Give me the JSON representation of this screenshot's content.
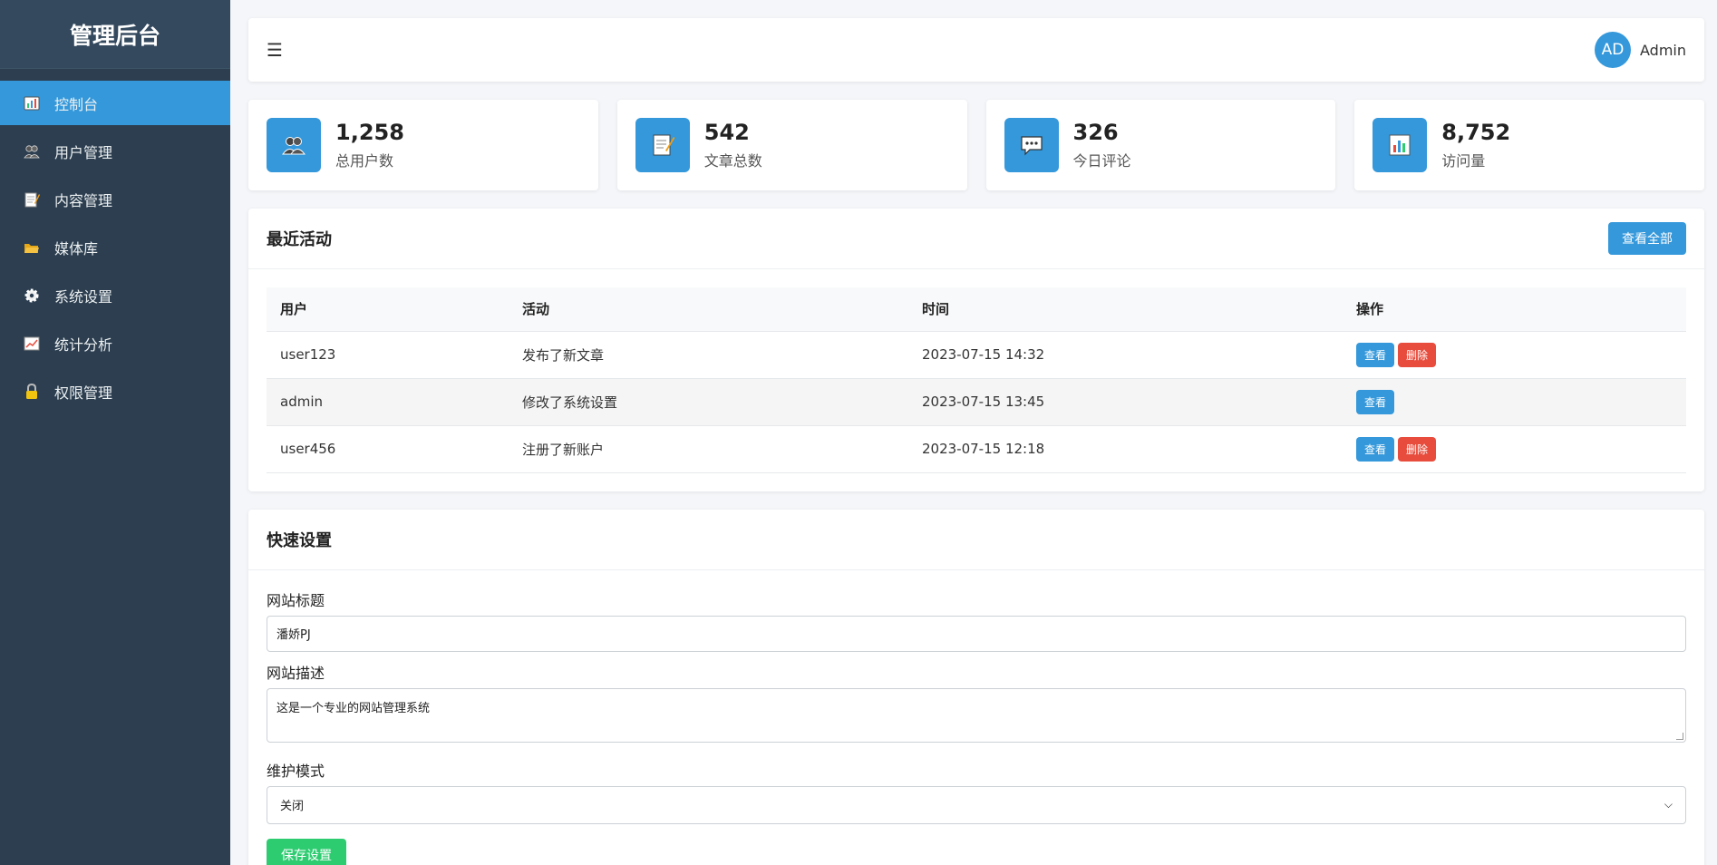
{
  "sidebar": {
    "title": "管理后台",
    "items": [
      {
        "label": "控制台",
        "icon": "dashboard-icon",
        "active": true
      },
      {
        "label": "用户管理",
        "icon": "users-icon"
      },
      {
        "label": "内容管理",
        "icon": "content-icon"
      },
      {
        "label": "媒体库",
        "icon": "folder-icon"
      },
      {
        "label": "系统设置",
        "icon": "gear-icon"
      },
      {
        "label": "统计分析",
        "icon": "chart-icon"
      },
      {
        "label": "权限管理",
        "icon": "lock-icon"
      }
    ]
  },
  "header": {
    "menu_icon": "☰",
    "avatar": "AD",
    "username": "Admin"
  },
  "stats": [
    {
      "number": "1,258",
      "label": "总用户数",
      "icon": "users-icon"
    },
    {
      "number": "542",
      "label": "文章总数",
      "icon": "memo-icon"
    },
    {
      "number": "326",
      "label": "今日评论",
      "icon": "comment-icon"
    },
    {
      "number": "8,752",
      "label": "访问量",
      "icon": "bar-chart-icon"
    }
  ],
  "activity": {
    "title": "最近活动",
    "view_all": "查看全部",
    "columns": [
      "用户",
      "活动",
      "时间",
      "操作"
    ],
    "rows": [
      {
        "user": "user123",
        "action": "发布了新文章",
        "time": "2023-07-15 14:32",
        "view": "查看",
        "delete": "删除"
      },
      {
        "user": "admin",
        "action": "修改了系统设置",
        "time": "2023-07-15 13:45",
        "view": "查看"
      },
      {
        "user": "user456",
        "action": "注册了新账户",
        "time": "2023-07-15 12:18",
        "view": "查看",
        "delete": "删除"
      }
    ]
  },
  "settings": {
    "title": "快速设置",
    "site_title_label": "网站标题",
    "site_title_value": "潘娇PJ",
    "site_desc_label": "网站描述",
    "site_desc_value": "这是一个专业的网站管理系统",
    "maintenance_label": "维护模式",
    "maintenance_value": "关闭",
    "save_label": "保存设置"
  },
  "colors": {
    "sidebar_bg": "#2c3e50",
    "primary": "#3498db",
    "danger": "#e74c3c",
    "success": "#2ecc71"
  }
}
